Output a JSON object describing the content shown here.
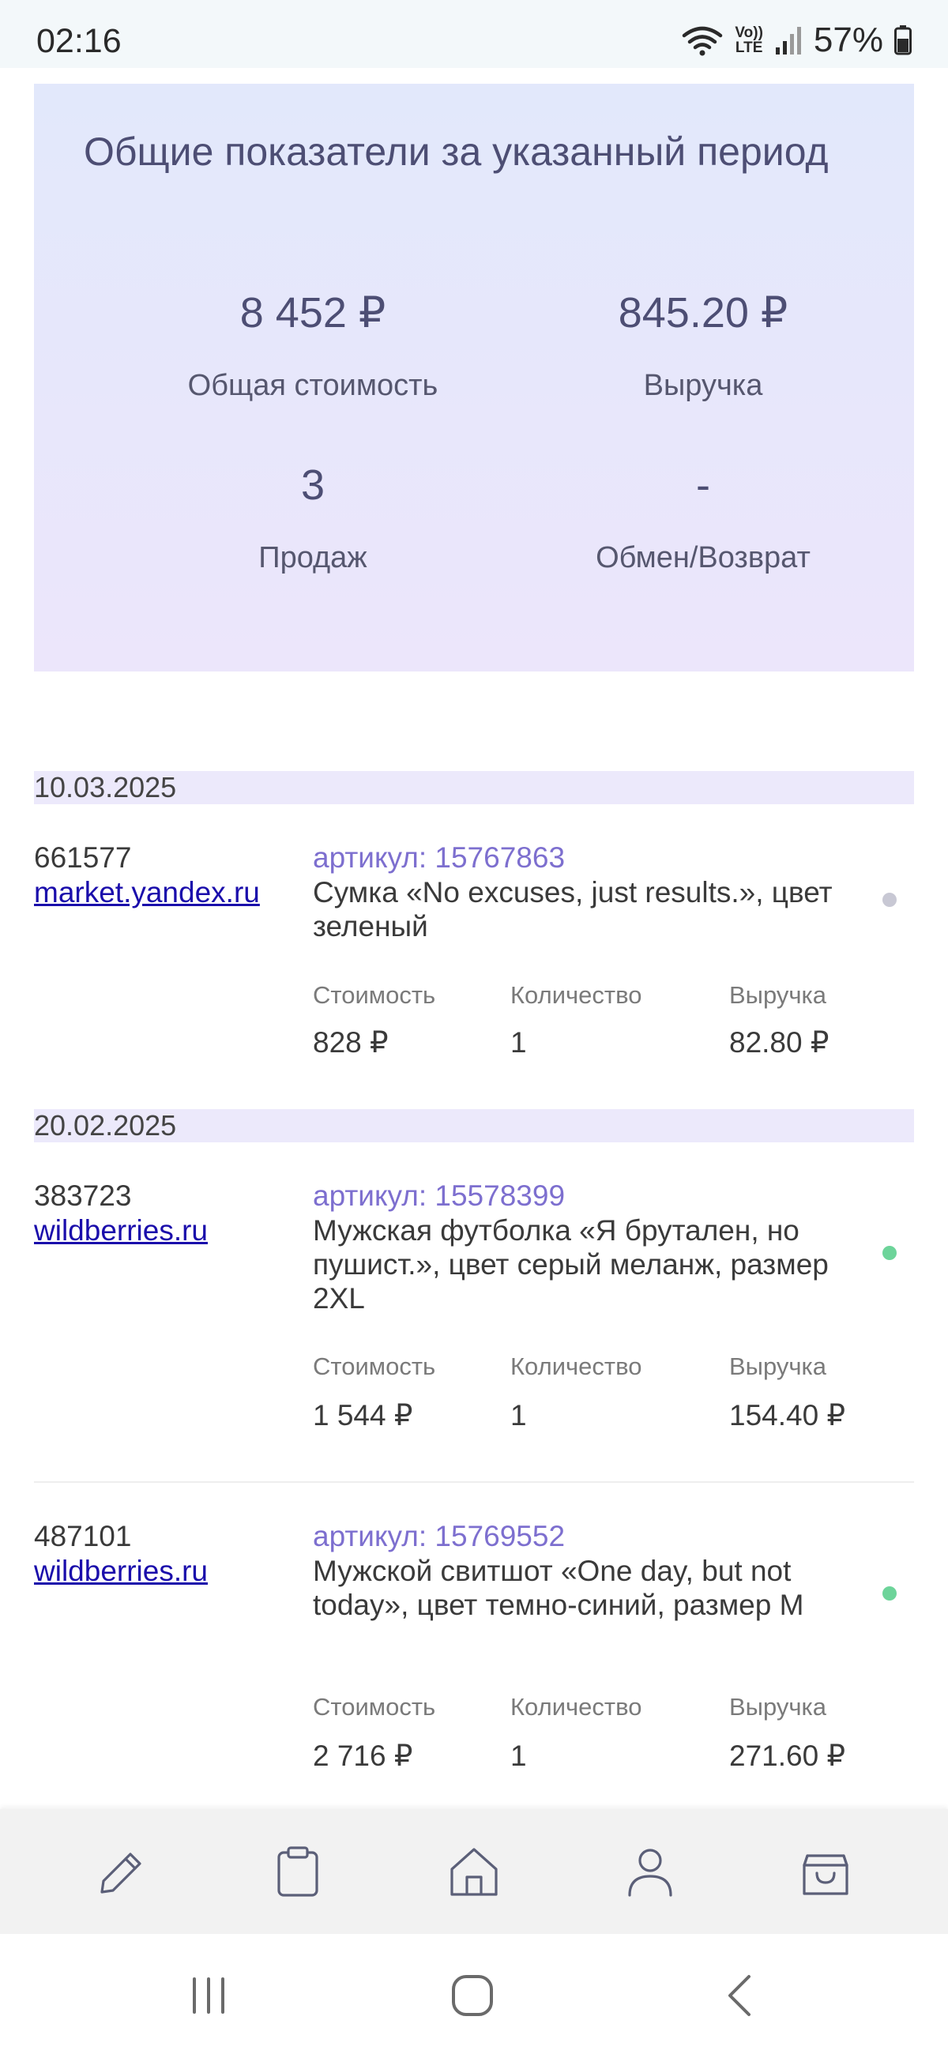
{
  "status_bar": {
    "time": "02:16",
    "network_top": "Vo))",
    "network_bottom": "LTE",
    "battery_percent": "57%"
  },
  "summary": {
    "title": "Общие показатели за указанный период",
    "total_cost_value": "8 452 ₽",
    "total_cost_label": "Общая стоимость",
    "revenue_value": "845.20 ₽",
    "revenue_label": "Выручка",
    "sales_value": "3",
    "sales_label": "Продаж",
    "returns_value": "-",
    "returns_label": "Обмен/Возврат"
  },
  "column_headers": {
    "cost": "Стоимость",
    "quantity": "Количество",
    "revenue": "Выручка"
  },
  "groups": [
    {
      "date": "10.03.2025",
      "orders": [
        {
          "id": "661577",
          "store": "market.yandex.ru",
          "sku": "артикул: 15767863",
          "description": "Сумка «No excuses, just results.», цвет зеленый",
          "status_color": "#c8c8d4",
          "cost": "828 ₽",
          "quantity": "1",
          "revenue": "82.80 ₽"
        }
      ]
    },
    {
      "date": "20.02.2025",
      "orders": [
        {
          "id": "383723",
          "store": "wildberries.ru",
          "sku": "артикул: 15578399",
          "description": "Мужская футболка «Я брутален, но пушист.», цвет серый меланж, размер 2XL",
          "status_color": "#6dd49a",
          "cost": "1 544 ₽",
          "quantity": "1",
          "revenue": "154.40 ₽"
        },
        {
          "id": "487101",
          "store": "wildberries.ru",
          "sku": "артикул: 15769552",
          "description": "Мужской свитшот «One day, but not today», цвет темно-синий, размер M",
          "status_color": "#6dd49a",
          "cost": "2 716 ₽",
          "quantity": "1",
          "revenue": "271.60 ₽"
        }
      ]
    }
  ],
  "bottom_nav": {
    "items": [
      "pencil-icon",
      "clipboard-icon",
      "home-icon",
      "user-icon",
      "shopping-bag-icon"
    ],
    "icon_color": "#5b5f78"
  },
  "system_nav": {
    "items": [
      "recent-apps-icon",
      "home-circle-icon",
      "back-icon"
    ]
  }
}
